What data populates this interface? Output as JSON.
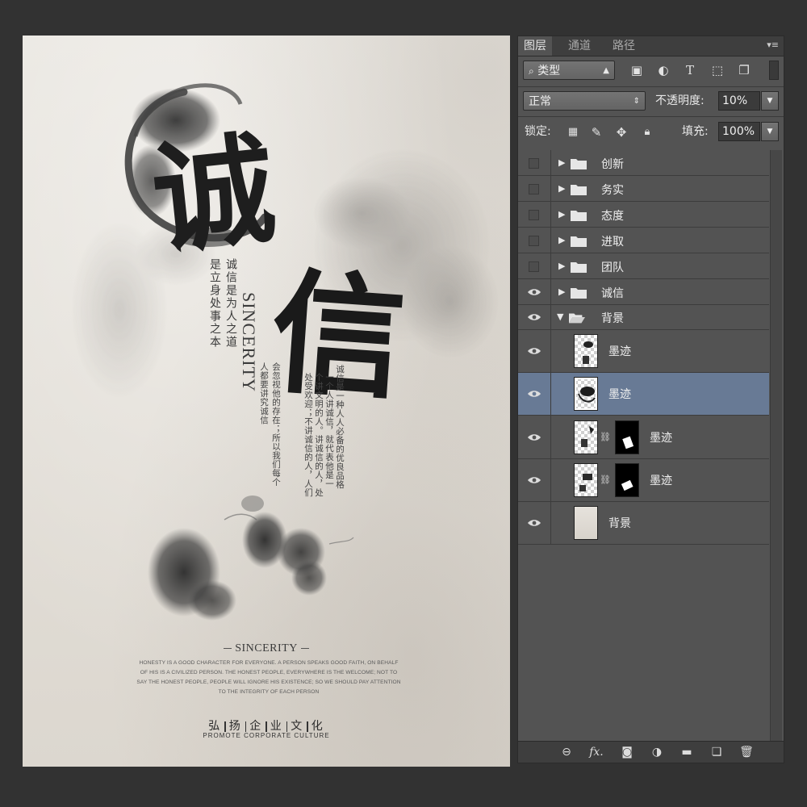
{
  "poster": {
    "big_char_1": "诚",
    "big_char_2": "信",
    "sincerity_vertical": "SINCERITY",
    "slogan_col_1": "诚信是为人之道",
    "slogan_col_2": "是立身处事之本",
    "body_cols": [
      "诚信是一种人人必备的优良品格",
      "一个人讲诚信，就代表他是一",
      "个讲文明的人。讲诚信的人，处",
      "处受欢迎；不讲诚信的人，人们",
      "会忽视他的存在；所以我们每个",
      "人都要讲究诚信"
    ],
    "subtitle": "SINCERITY",
    "paragraph": "HONESTY IS A GOOD CHARACTER FOR EVERYONE. A PERSON SPEAKS GOOD FAITH, ON BEHALF OF HIS IS A CIVILIZED PERSON. THE HONEST PEOPLE, EVERYWHERE IS THE WELCOME; NOT TO SAY THE HONEST PEOPLE, PEOPLE WILL IGNORE HIS EXISTENCE; SO WE SHOULD PAY ATTENTION TO THE INTEGRITY OF EACH PERSON",
    "promote_cn": [
      "弘",
      "扬",
      "企",
      "业",
      "文",
      "化"
    ],
    "promote_en": "PROMOTE CORPORATE CULTURE"
  },
  "panel": {
    "tabs": [
      "图层",
      "通道",
      "路径"
    ],
    "active_tab": "图层",
    "filter_kind": "类型",
    "blend_mode": "正常",
    "opacity_label": "不透明度:",
    "opacity_value": "10%",
    "lock_label": "锁定:",
    "fill_label": "填充:",
    "fill_value": "100%",
    "icons": {
      "search": "search-icon",
      "image_filter": "image-filter-icon",
      "adjust_filter": "adjustment-filter-icon",
      "text_filter": "text-filter-icon",
      "shape_filter": "shape-filter-icon",
      "smart_filter": "smart-object-filter-icon"
    },
    "layers": [
      {
        "name": "创新",
        "type": "group",
        "visible": false,
        "expanded": false
      },
      {
        "name": "务实",
        "type": "group",
        "visible": false,
        "expanded": false
      },
      {
        "name": "态度",
        "type": "group",
        "visible": false,
        "expanded": false
      },
      {
        "name": "进取",
        "type": "group",
        "visible": false,
        "expanded": false
      },
      {
        "name": "团队",
        "type": "group",
        "visible": false,
        "expanded": false
      },
      {
        "name": "诚信",
        "type": "group",
        "visible": true,
        "expanded": false
      },
      {
        "name": "背景",
        "type": "group",
        "visible": true,
        "expanded": true
      },
      {
        "name": "墨迹",
        "type": "layer",
        "visible": true,
        "selected": false,
        "mask": false
      },
      {
        "name": "墨迹",
        "type": "layer",
        "visible": true,
        "selected": true,
        "mask": false
      },
      {
        "name": "墨迹",
        "type": "layer",
        "visible": true,
        "selected": false,
        "mask": true
      },
      {
        "name": "墨迹",
        "type": "layer",
        "visible": true,
        "selected": false,
        "mask": true
      },
      {
        "name": "背景",
        "type": "background",
        "visible": true,
        "selected": false,
        "mask": false
      }
    ],
    "bottom_icons": [
      "link-layers-icon",
      "fx-icon",
      "add-mask-icon",
      "adjustment-layer-icon",
      "new-group-icon",
      "new-layer-icon",
      "delete-icon"
    ],
    "fx_label": "fx."
  },
  "colors": {
    "workspace": "#323232",
    "panel": "#535353",
    "selected_layer": "#687a95"
  }
}
